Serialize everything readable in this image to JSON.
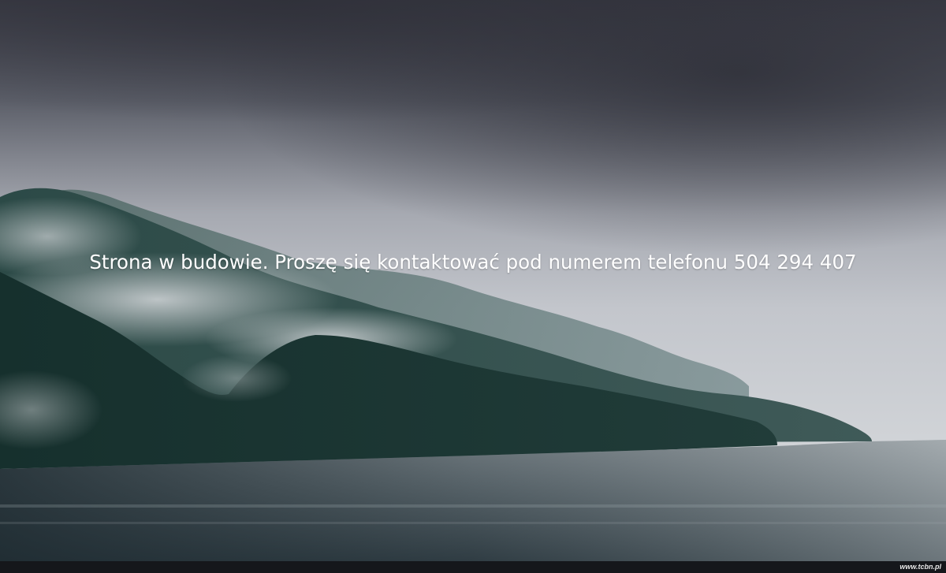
{
  "page": {
    "message": "Strona w budowie. Proszę się kontaktować pod numerem telefonu 504 294 407"
  },
  "footer": {
    "link_text": "www.tcbn.pl"
  },
  "colors": {
    "text": "#ffffff",
    "footer_bg": "#15171b",
    "sky_dark": "#3b3c46",
    "sky_light": "#c9ccd2",
    "forest": "#1f3a38",
    "water": "#5f6b72"
  }
}
